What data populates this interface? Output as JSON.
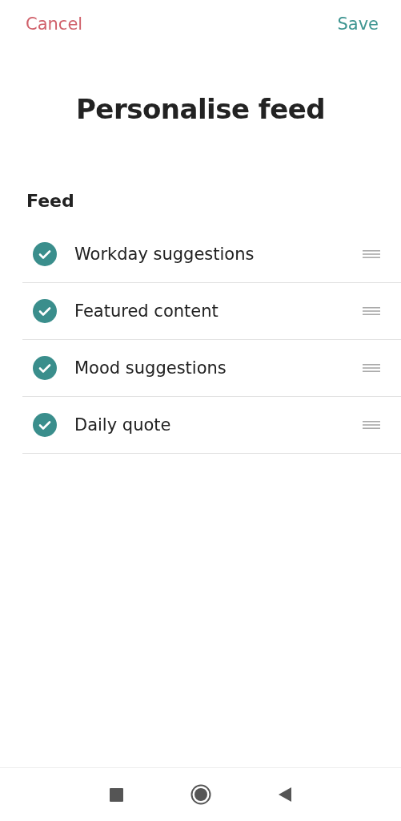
{
  "header": {
    "cancel": "Cancel",
    "save": "Save"
  },
  "title": "Personalise feed",
  "section": {
    "heading": "Feed",
    "items": [
      {
        "label": "Workday suggestions",
        "checked": true
      },
      {
        "label": "Featured content",
        "checked": true
      },
      {
        "label": "Mood suggestions",
        "checked": true
      },
      {
        "label": "Daily quote",
        "checked": true
      }
    ]
  }
}
